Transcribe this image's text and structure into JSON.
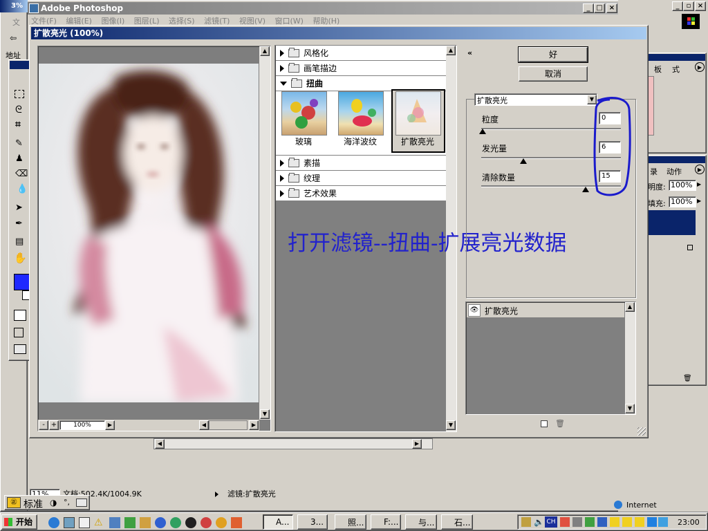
{
  "photoshop": {
    "title": "Adobe Photoshop",
    "menu": [
      "文件(F)",
      "编辑(E)",
      "图像(I)",
      "图层(L)",
      "选择(S)",
      "滤镜(T)",
      "视图(V)",
      "窗口(W)",
      "帮助(H)"
    ]
  },
  "left_strip": {
    "label1": "文",
    "label2": "地址"
  },
  "filter_dialog": {
    "title": "扩散亮光 (100%)",
    "ok_label": "好",
    "cancel_label": "取消",
    "preview_zoom": "100%",
    "categories_top": [
      {
        "label": "风格化"
      },
      {
        "label": "画笔描边"
      }
    ],
    "open_category": "扭曲",
    "thumbnails": [
      {
        "label": "玻璃"
      },
      {
        "label": "海洋波纹"
      },
      {
        "label": "扩散亮光"
      }
    ],
    "categories_bottom": [
      {
        "label": "素描"
      },
      {
        "label": "纹理"
      },
      {
        "label": "艺术效果"
      }
    ],
    "filter_select": "扩散亮光",
    "params": [
      {
        "label": "粒度",
        "value": "0",
        "level": 0
      },
      {
        "label": "发光量",
        "value": "6",
        "level": 0.3
      },
      {
        "label": "清除数量",
        "value": "15",
        "level": 0.75
      }
    ],
    "layer_item": "扩散亮光",
    "annotation": "打开滤镜--扭曲-扩展亮光数据"
  },
  "status_bar": {
    "zoom": "11%",
    "doc": "文档:502.4K/1004.9K",
    "filter": "滤镜:扩散亮光"
  },
  "ime_bar": {
    "mode": "标准"
  },
  "right_panels": {
    "history_tab": "录",
    "actions_tab": "动作",
    "brushes_tabs": [
      "板",
      "式"
    ],
    "opacity_label": "明度:",
    "opacity_value": "100%",
    "fill_label": "填充:",
    "fill_value": "100%"
  },
  "ie_status": {
    "zone": "Internet"
  },
  "taskbar": {
    "start": "开始",
    "buttons": [
      "A...",
      "3...",
      "照...",
      "F:...",
      "与...",
      "石..."
    ],
    "clock": "23:00",
    "ch": "CH"
  },
  "colors": {
    "titlebar": "#0a246a",
    "face": "#d4d0c8",
    "annotation": "#2222cc",
    "highlight_circle": "#1a1acc",
    "foreground_swatch": "#1e28ff"
  }
}
